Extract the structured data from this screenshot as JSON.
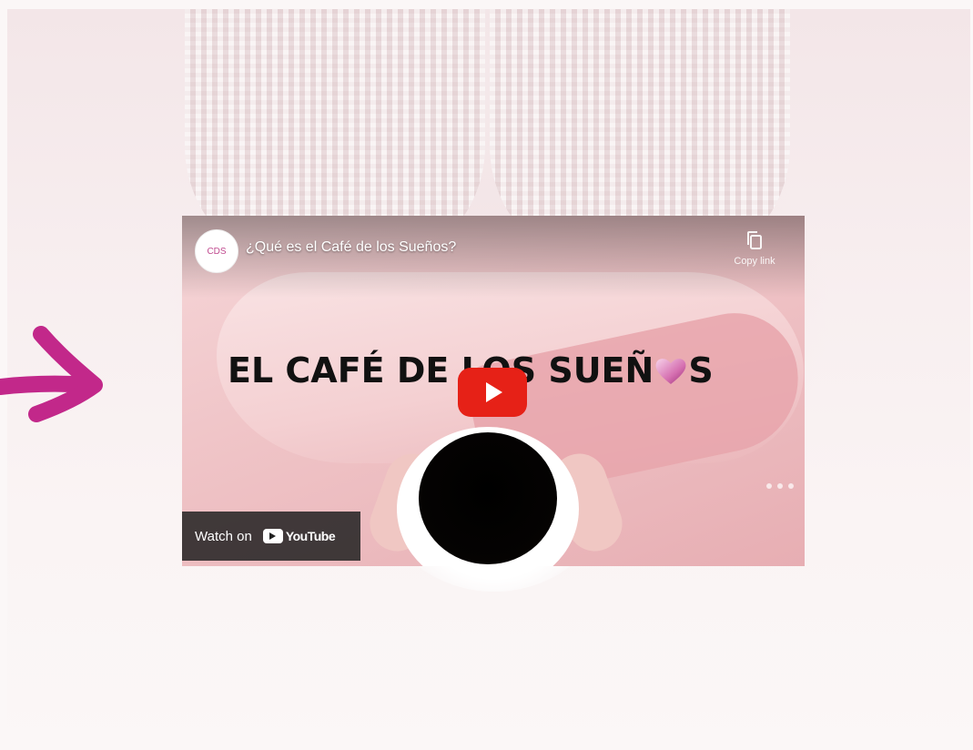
{
  "video": {
    "title": "¿Qué es el Café de los Sueños?",
    "copy_link_label": "Copy link",
    "headline_before_heart": "EL CAFÉ DE LOS SUEÑ",
    "headline_after_heart": "S",
    "watch_on_label": "Watch on",
    "platform_name": "YouTube",
    "channel_avatar_text": "CDS"
  },
  "colors": {
    "arrow": "#c2288a",
    "play_button": "#e62117",
    "headline": "#111111"
  },
  "icons": {
    "arrow": "arrow-right-icon",
    "copy": "copy-icon",
    "play": "play-icon",
    "youtube": "youtube-logo-icon",
    "heart": "heart-icon"
  }
}
